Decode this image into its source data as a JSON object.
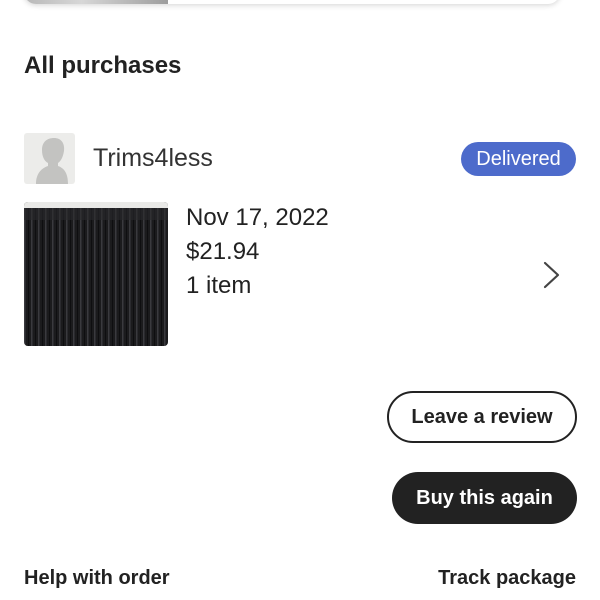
{
  "section": {
    "title": "All purchases"
  },
  "order": {
    "shop_name": "Trims4less",
    "status": "Delivered",
    "date": "Nov 17, 2022",
    "price": "$21.94",
    "item_count": "1 item"
  },
  "actions": {
    "leave_review": "Leave a review",
    "buy_again": "Buy this again"
  },
  "footer": {
    "help": "Help with order",
    "track": "Track package"
  },
  "icons": {
    "avatar": "person-silhouette-icon",
    "chevron": "chevron-right-icon"
  },
  "colors": {
    "status_badge": "#4d6bcb",
    "primary_button": "#222222",
    "text": "#222222"
  }
}
